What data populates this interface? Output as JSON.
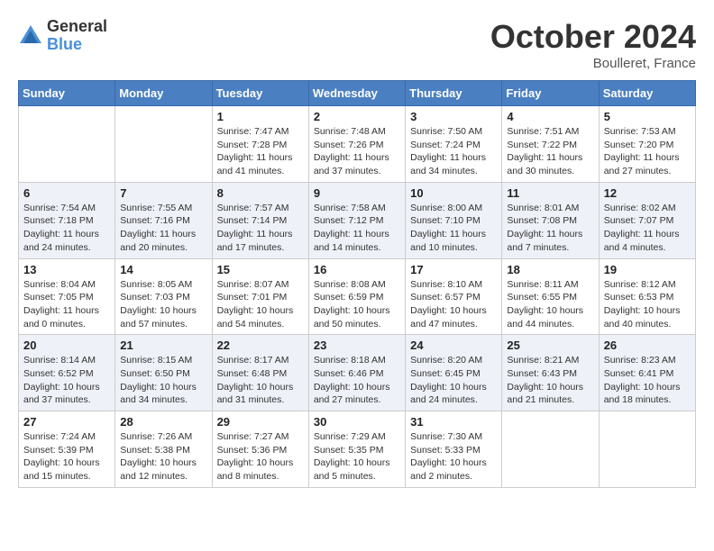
{
  "logo": {
    "general": "General",
    "blue": "Blue"
  },
  "title": {
    "month": "October 2024",
    "location": "Boulleret, France"
  },
  "headers": [
    "Sunday",
    "Monday",
    "Tuesday",
    "Wednesday",
    "Thursday",
    "Friday",
    "Saturday"
  ],
  "weeks": [
    [
      {
        "day": "",
        "info": ""
      },
      {
        "day": "",
        "info": ""
      },
      {
        "day": "1",
        "info": "Sunrise: 7:47 AM\nSunset: 7:28 PM\nDaylight: 11 hours and 41 minutes."
      },
      {
        "day": "2",
        "info": "Sunrise: 7:48 AM\nSunset: 7:26 PM\nDaylight: 11 hours and 37 minutes."
      },
      {
        "day": "3",
        "info": "Sunrise: 7:50 AM\nSunset: 7:24 PM\nDaylight: 11 hours and 34 minutes."
      },
      {
        "day": "4",
        "info": "Sunrise: 7:51 AM\nSunset: 7:22 PM\nDaylight: 11 hours and 30 minutes."
      },
      {
        "day": "5",
        "info": "Sunrise: 7:53 AM\nSunset: 7:20 PM\nDaylight: 11 hours and 27 minutes."
      }
    ],
    [
      {
        "day": "6",
        "info": "Sunrise: 7:54 AM\nSunset: 7:18 PM\nDaylight: 11 hours and 24 minutes."
      },
      {
        "day": "7",
        "info": "Sunrise: 7:55 AM\nSunset: 7:16 PM\nDaylight: 11 hours and 20 minutes."
      },
      {
        "day": "8",
        "info": "Sunrise: 7:57 AM\nSunset: 7:14 PM\nDaylight: 11 hours and 17 minutes."
      },
      {
        "day": "9",
        "info": "Sunrise: 7:58 AM\nSunset: 7:12 PM\nDaylight: 11 hours and 14 minutes."
      },
      {
        "day": "10",
        "info": "Sunrise: 8:00 AM\nSunset: 7:10 PM\nDaylight: 11 hours and 10 minutes."
      },
      {
        "day": "11",
        "info": "Sunrise: 8:01 AM\nSunset: 7:08 PM\nDaylight: 11 hours and 7 minutes."
      },
      {
        "day": "12",
        "info": "Sunrise: 8:02 AM\nSunset: 7:07 PM\nDaylight: 11 hours and 4 minutes."
      }
    ],
    [
      {
        "day": "13",
        "info": "Sunrise: 8:04 AM\nSunset: 7:05 PM\nDaylight: 11 hours and 0 minutes."
      },
      {
        "day": "14",
        "info": "Sunrise: 8:05 AM\nSunset: 7:03 PM\nDaylight: 10 hours and 57 minutes."
      },
      {
        "day": "15",
        "info": "Sunrise: 8:07 AM\nSunset: 7:01 PM\nDaylight: 10 hours and 54 minutes."
      },
      {
        "day": "16",
        "info": "Sunrise: 8:08 AM\nSunset: 6:59 PM\nDaylight: 10 hours and 50 minutes."
      },
      {
        "day": "17",
        "info": "Sunrise: 8:10 AM\nSunset: 6:57 PM\nDaylight: 10 hours and 47 minutes."
      },
      {
        "day": "18",
        "info": "Sunrise: 8:11 AM\nSunset: 6:55 PM\nDaylight: 10 hours and 44 minutes."
      },
      {
        "day": "19",
        "info": "Sunrise: 8:12 AM\nSunset: 6:53 PM\nDaylight: 10 hours and 40 minutes."
      }
    ],
    [
      {
        "day": "20",
        "info": "Sunrise: 8:14 AM\nSunset: 6:52 PM\nDaylight: 10 hours and 37 minutes."
      },
      {
        "day": "21",
        "info": "Sunrise: 8:15 AM\nSunset: 6:50 PM\nDaylight: 10 hours and 34 minutes."
      },
      {
        "day": "22",
        "info": "Sunrise: 8:17 AM\nSunset: 6:48 PM\nDaylight: 10 hours and 31 minutes."
      },
      {
        "day": "23",
        "info": "Sunrise: 8:18 AM\nSunset: 6:46 PM\nDaylight: 10 hours and 27 minutes."
      },
      {
        "day": "24",
        "info": "Sunrise: 8:20 AM\nSunset: 6:45 PM\nDaylight: 10 hours and 24 minutes."
      },
      {
        "day": "25",
        "info": "Sunrise: 8:21 AM\nSunset: 6:43 PM\nDaylight: 10 hours and 21 minutes."
      },
      {
        "day": "26",
        "info": "Sunrise: 8:23 AM\nSunset: 6:41 PM\nDaylight: 10 hours and 18 minutes."
      }
    ],
    [
      {
        "day": "27",
        "info": "Sunrise: 7:24 AM\nSunset: 5:39 PM\nDaylight: 10 hours and 15 minutes."
      },
      {
        "day": "28",
        "info": "Sunrise: 7:26 AM\nSunset: 5:38 PM\nDaylight: 10 hours and 12 minutes."
      },
      {
        "day": "29",
        "info": "Sunrise: 7:27 AM\nSunset: 5:36 PM\nDaylight: 10 hours and 8 minutes."
      },
      {
        "day": "30",
        "info": "Sunrise: 7:29 AM\nSunset: 5:35 PM\nDaylight: 10 hours and 5 minutes."
      },
      {
        "day": "31",
        "info": "Sunrise: 7:30 AM\nSunset: 5:33 PM\nDaylight: 10 hours and 2 minutes."
      },
      {
        "day": "",
        "info": ""
      },
      {
        "day": "",
        "info": ""
      }
    ]
  ]
}
